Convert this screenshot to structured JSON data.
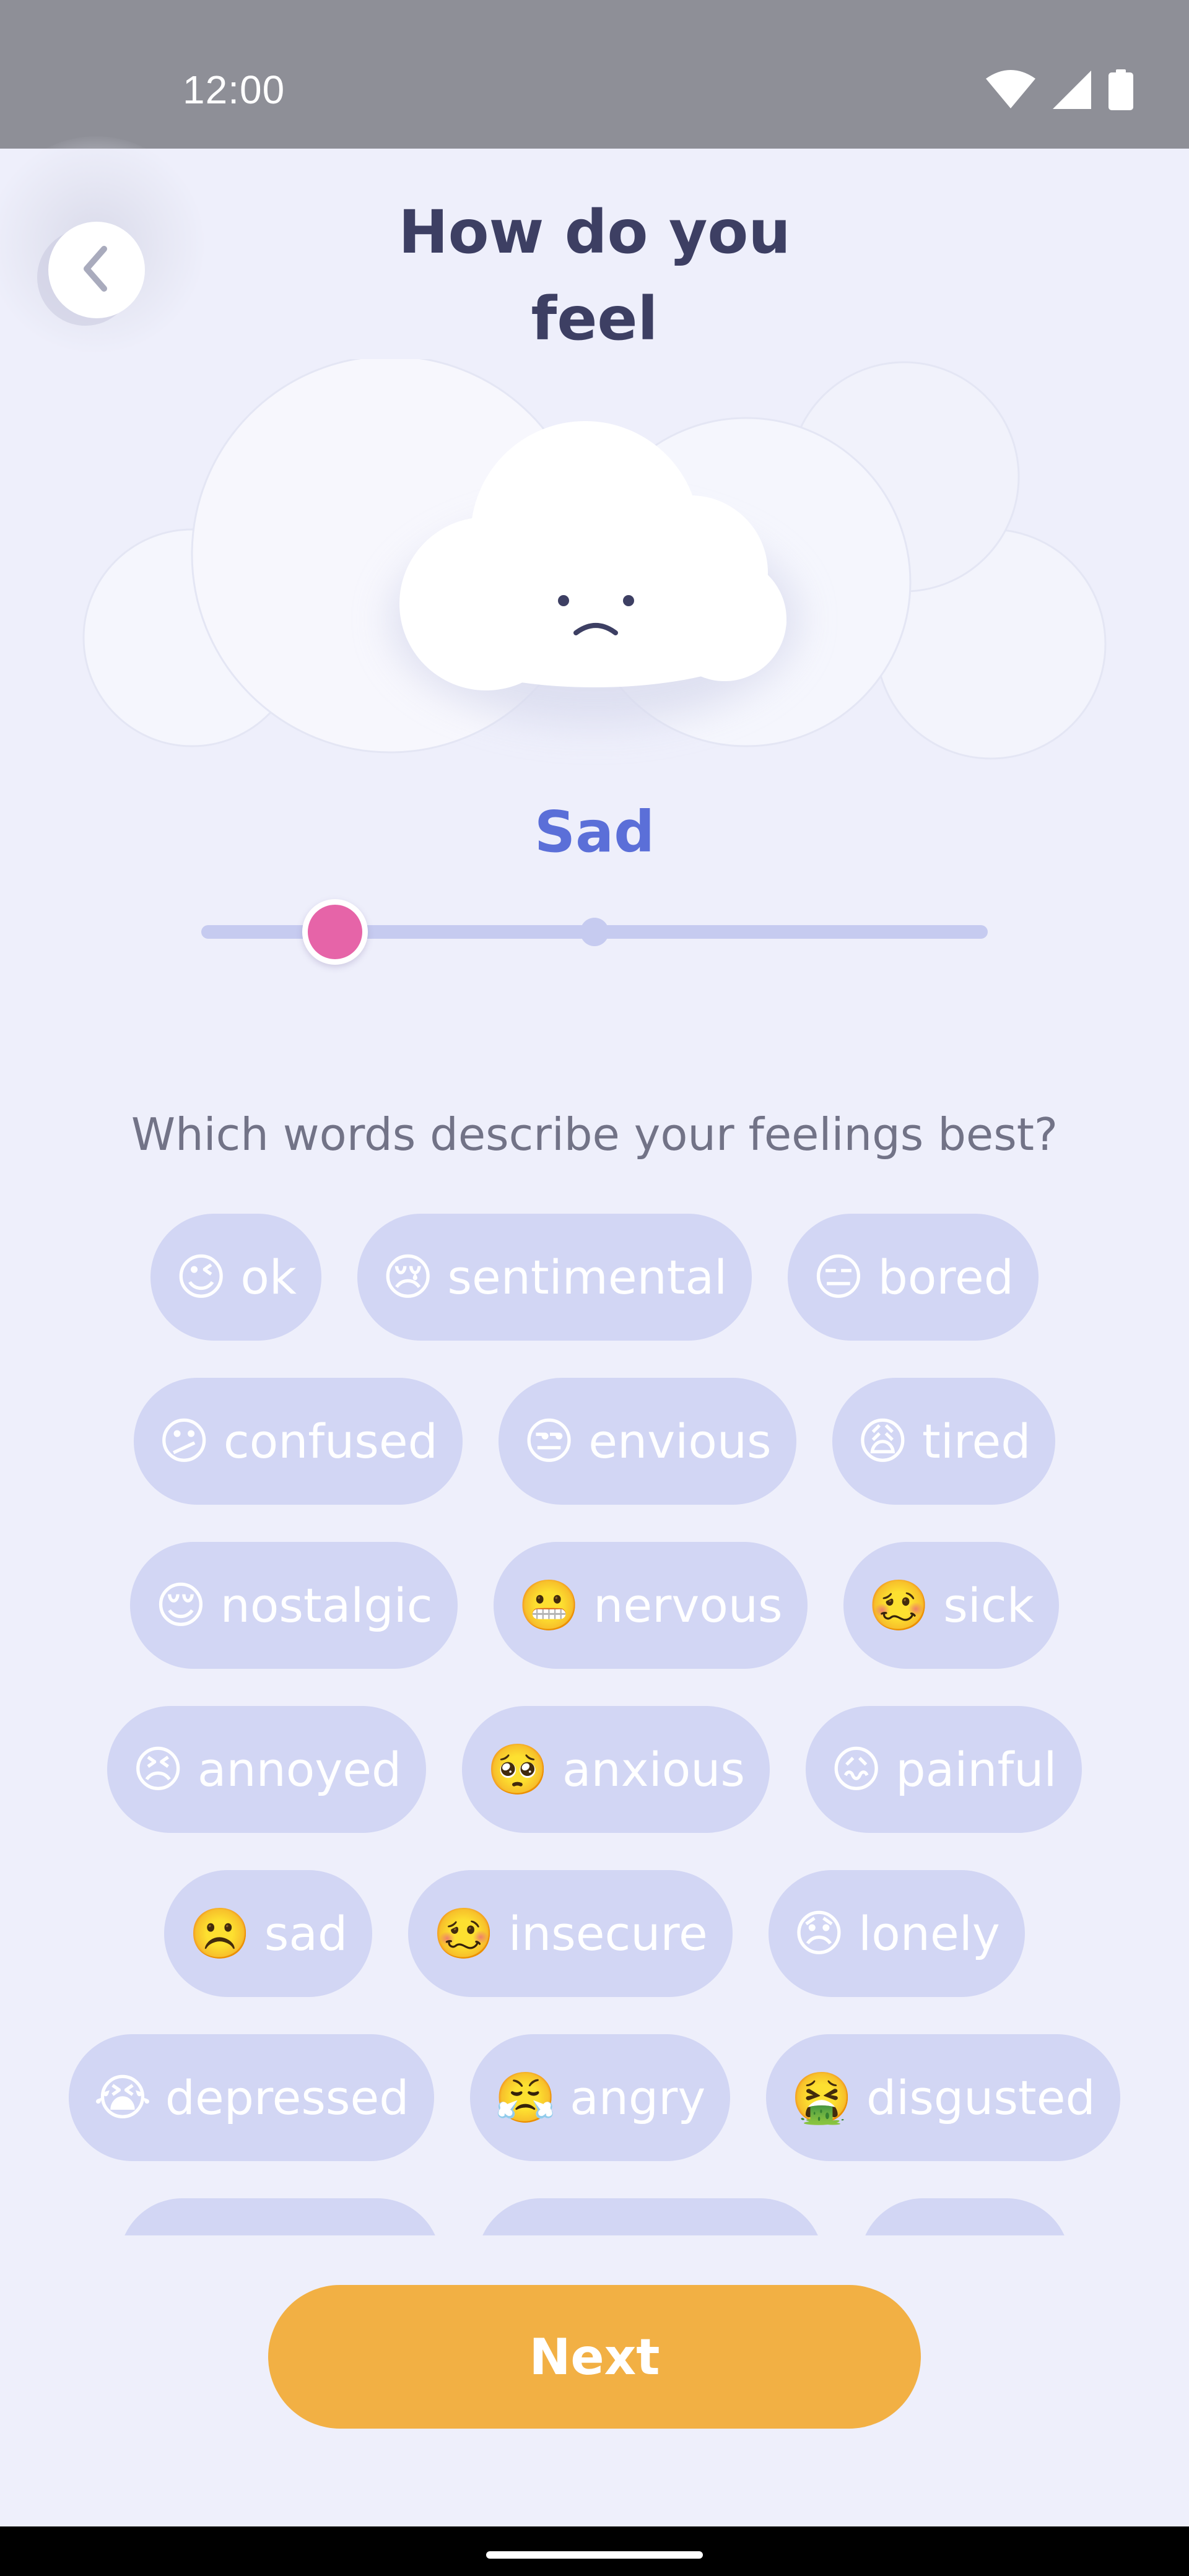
{
  "status_bar": {
    "time": "12:00",
    "icons": [
      "wifi-icon",
      "signal-icon",
      "battery-icon"
    ]
  },
  "header": {
    "back_icon": "chevron-left-icon",
    "title_line1": "How do you",
    "title_line2": "feel"
  },
  "mood": {
    "label": "Sad",
    "slider_value": 0.17
  },
  "question": "Which words describe your feelings best?",
  "chip_rows": [
    [
      {
        "emoji": "😉",
        "label": "ok"
      },
      {
        "emoji": "😢",
        "label": "sentimental"
      },
      {
        "emoji": "😑",
        "label": "bored"
      }
    ],
    [
      {
        "emoji": "😕",
        "label": "confused"
      },
      {
        "emoji": "😒",
        "label": "envious"
      },
      {
        "emoji": "😩",
        "label": "tired"
      }
    ],
    [
      {
        "emoji": "😌",
        "label": "nostalgic"
      },
      {
        "emoji": "😬",
        "label": "nervous"
      },
      {
        "emoji": "🥴",
        "label": "sick"
      }
    ],
    [
      {
        "emoji": "😣",
        "label": "annoyed"
      },
      {
        "emoji": "🥺",
        "label": "anxious"
      },
      {
        "emoji": "😖",
        "label": "painful"
      }
    ],
    [
      {
        "emoji": "☹️",
        "label": "sad"
      },
      {
        "emoji": "🥴",
        "label": "insecure"
      },
      {
        "emoji": "😞",
        "label": "lonely"
      }
    ],
    [
      {
        "emoji": "😭",
        "label": "depressed"
      },
      {
        "emoji": "😤",
        "label": "angry"
      },
      {
        "emoji": "🤮",
        "label": "disgusted"
      }
    ],
    [
      {
        "emoji": "",
        "label": ""
      },
      {
        "emoji": "",
        "label": ""
      },
      {
        "emoji": "",
        "label": ""
      }
    ]
  ],
  "next_button": {
    "label": "Next"
  },
  "colors": {
    "background": "#eeeffb",
    "title": "#3d3f63",
    "accent": "#5b6fd8",
    "thumb": "#e664a8",
    "chip": "#d2d6f4",
    "next": "#f2b044"
  }
}
